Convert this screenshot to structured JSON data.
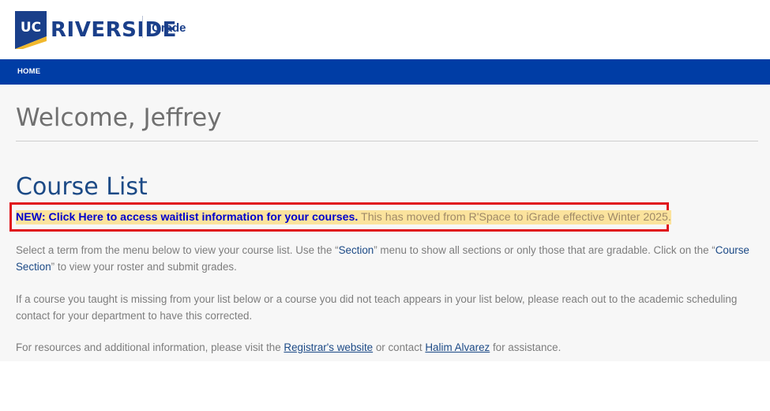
{
  "header": {
    "logo_mark": "UC",
    "logo_name": "RIVERSIDE",
    "app_name": "iGrade",
    "brand_colors": {
      "blue": "#1a3f8a",
      "gold": "#f1b82d"
    }
  },
  "nav": {
    "home_label": "HOME",
    "color": "#003da5"
  },
  "main": {
    "welcome": "Welcome, Jeffrey",
    "title": "Course List",
    "notice": {
      "link_text": "NEW: Click Here to access waitlist information for your courses.",
      "rest_text": " This has moved from R'Space to iGrade effective Winter 2025.",
      "highlight_color": "#fbe39d",
      "box_color": "#e0131b"
    },
    "para1": {
      "a": "Select a term from the menu below to view your course list. Use the “",
      "section": "Section",
      "b": "” menu to show all sections or only those that are gradable. Click on the “",
      "course_section": "Course Section",
      "c": "” to view your roster and submit grades."
    },
    "para2": "If a course you taught is missing from your list below or a course you did not teach appears in your list below, please reach out to the academic scheduling contact for your department to have this corrected.",
    "para3": {
      "a": "For resources and additional information, please visit the ",
      "registrar_link": "Registrar's website",
      "b": " or contact ",
      "contact_link": "Halim Alvarez",
      "c": " for assistance."
    }
  }
}
